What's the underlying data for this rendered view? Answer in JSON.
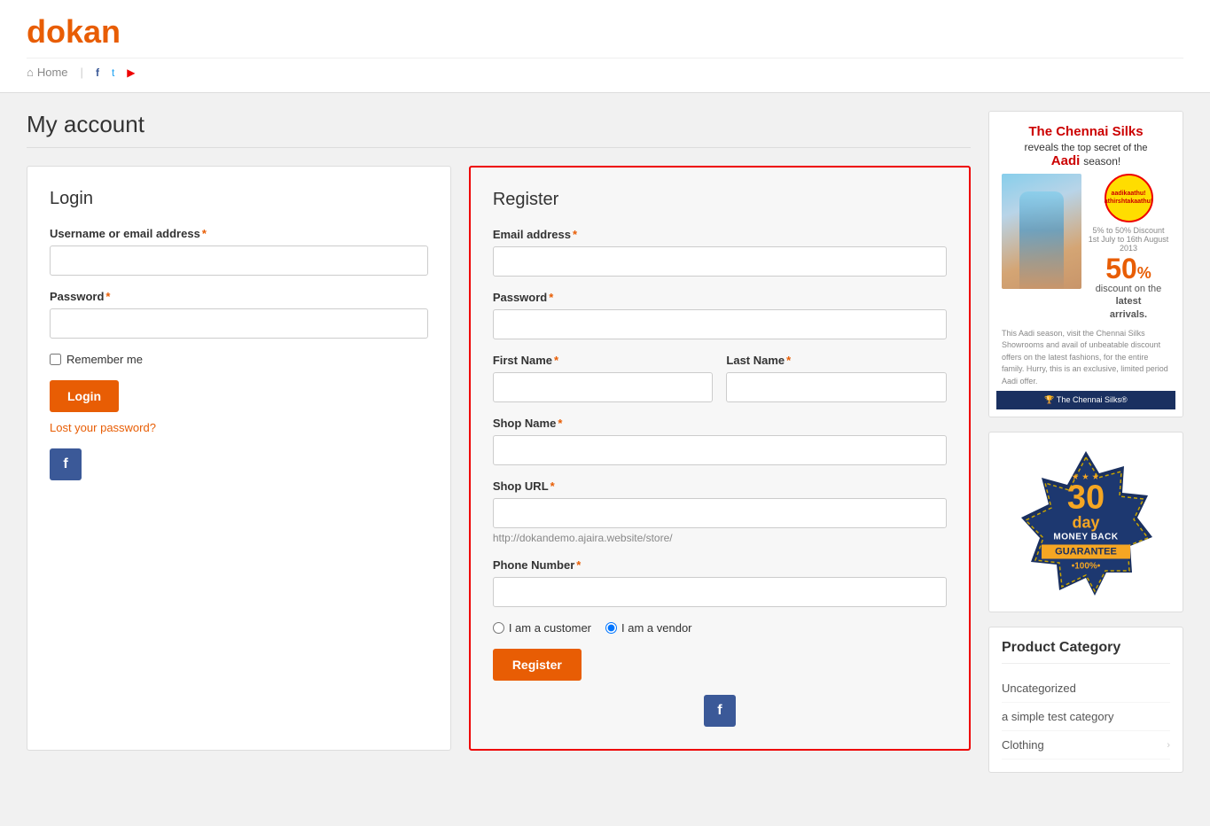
{
  "site": {
    "logo_prefix": "d",
    "logo_text": "okan",
    "brand": "dokan"
  },
  "nav": {
    "home_label": "Home",
    "facebook_icon": "f",
    "twitter_icon": "t",
    "youtube_icon": "▶"
  },
  "page": {
    "title": "My account"
  },
  "login": {
    "title": "Login",
    "username_label": "Username or email address",
    "username_required": "*",
    "username_placeholder": "",
    "password_label": "Password",
    "password_required": "*",
    "password_placeholder": "",
    "remember_me_label": "Remember me",
    "login_button": "Login",
    "lost_password_link": "Lost your password?",
    "facebook_button": "f"
  },
  "register": {
    "title": "Register",
    "email_label": "Email address",
    "email_required": "*",
    "email_placeholder": "",
    "password_label": "Password",
    "password_required": "*",
    "password_placeholder": "",
    "first_name_label": "First Name",
    "first_name_required": "*",
    "first_name_placeholder": "",
    "last_name_label": "Last Name",
    "last_name_required": "*",
    "last_name_placeholder": "",
    "shop_name_label": "Shop Name",
    "shop_name_required": "*",
    "shop_name_placeholder": "",
    "shop_url_label": "Shop URL",
    "shop_url_required": "*",
    "shop_url_placeholder": "",
    "shop_url_hint": "http://dokandemo.ajaira.website/store/",
    "phone_label": "Phone Number",
    "phone_required": "*",
    "phone_placeholder": "",
    "radio_customer_label": "I am a customer",
    "radio_vendor_label": "I am a vendor",
    "register_button": "Register",
    "facebook_button": "f"
  },
  "sidebar": {
    "ad": {
      "headline_part1": "The Chennai Silks",
      "headline_part2": "reveals",
      "headline_part3": "the top secret",
      "headline_part4": "of the",
      "headline_part5": "Aadi",
      "headline_part6": "season!",
      "discount_number": "50",
      "discount_symbol": "%",
      "discount_text": "discount on the latest arrivals.",
      "brand_name": "The Chennai Silks"
    },
    "guarantee": {
      "days": "30",
      "day_text": "day",
      "money_text": "MONEY BACK",
      "guarantee_text": "GUARANTEE",
      "percent_text": "•100%•"
    },
    "product_category": {
      "title": "Product Category",
      "items": [
        {
          "label": "Uncategorized",
          "has_arrow": false
        },
        {
          "label": "a simple test category",
          "has_arrow": false
        },
        {
          "label": "Clothing",
          "has_arrow": true
        }
      ]
    }
  }
}
